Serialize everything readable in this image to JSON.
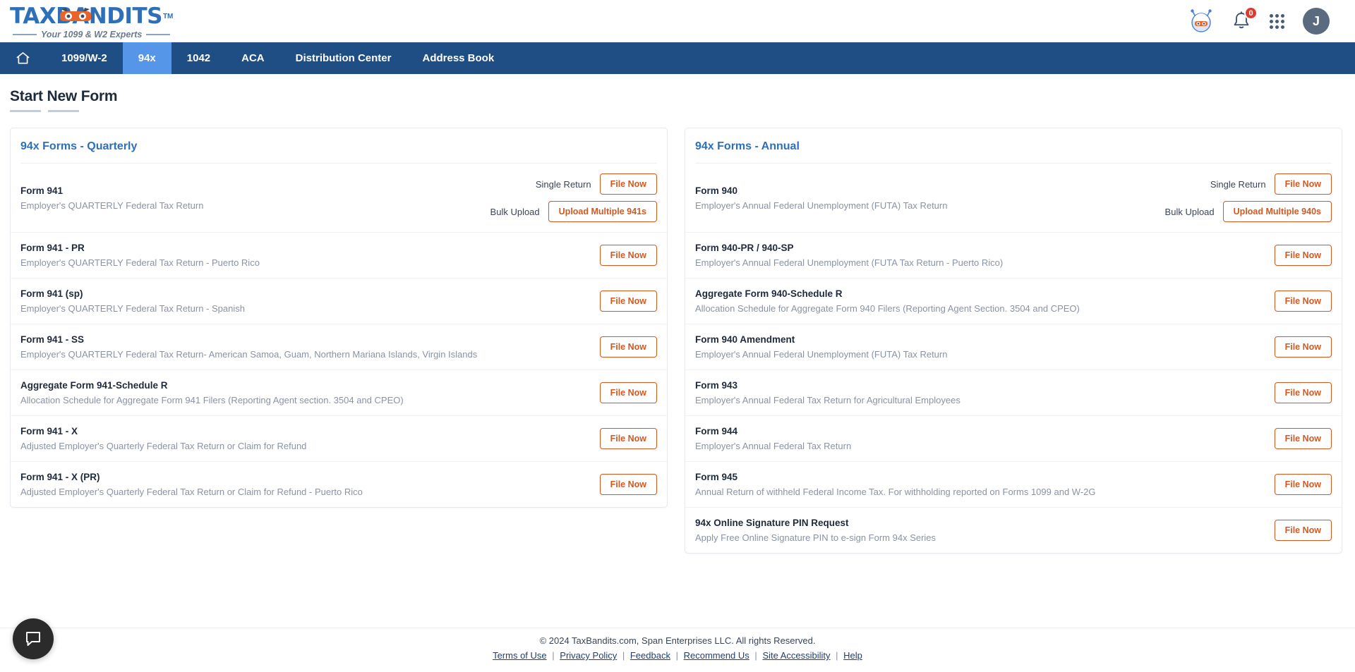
{
  "header": {
    "logo_text": "TAXBANDITS",
    "logo_tm": "TM",
    "tagline": "Your 1099 & W2 Experts",
    "notification_count": "0",
    "avatar_initial": "J"
  },
  "nav": {
    "home_label": "Home",
    "items": [
      {
        "label": "1099/W-2",
        "active": false
      },
      {
        "label": "94x",
        "active": true
      },
      {
        "label": "1042",
        "active": false
      },
      {
        "label": "ACA",
        "active": false
      },
      {
        "label": "Distribution Center",
        "active": false
      },
      {
        "label": "Address Book",
        "active": false
      }
    ]
  },
  "page": {
    "title": "Start New Form"
  },
  "labels": {
    "single_return": "Single Return",
    "bulk_upload": "Bulk Upload",
    "file_now": "File Now"
  },
  "cards": {
    "quarterly": {
      "title": "94x Forms - Quarterly",
      "rows": [
        {
          "name": "Form 941",
          "desc": "Employer's QUARTERLY Federal Tax Return",
          "single_label": "Single Return",
          "single_button": "File Now",
          "bulk_label": "Bulk Upload",
          "bulk_button": "Upload Multiple 941s"
        },
        {
          "name": "Form 941 - PR",
          "desc": "Employer's QUARTERLY Federal Tax Return - Puerto Rico",
          "single_button": "File Now"
        },
        {
          "name": "Form 941 (sp)",
          "desc": "Employer's QUARTERLY Federal Tax Return - Spanish",
          "single_button": "File Now"
        },
        {
          "name": "Form 941 - SS",
          "desc": "Employer's QUARTERLY Federal Tax Return- American Samoa, Guam, Northern Mariana Islands, Virgin Islands",
          "single_button": "File Now"
        },
        {
          "name": "Aggregate Form 941-Schedule R",
          "desc": "Allocation Schedule for Aggregate Form 941 Filers (Reporting Agent section. 3504 and CPEO)",
          "single_button": "File Now"
        },
        {
          "name": "Form 941 - X",
          "desc": "Adjusted Employer's Quarterly Federal Tax Return or Claim for Refund",
          "single_button": "File Now"
        },
        {
          "name": "Form 941 - X (PR)",
          "desc": "Adjusted Employer's Quarterly Federal Tax Return or Claim for Refund - Puerto Rico",
          "single_button": "File Now"
        }
      ]
    },
    "annual": {
      "title": "94x Forms - Annual",
      "rows": [
        {
          "name": "Form 940",
          "desc": "Employer's Annual Federal Unemployment (FUTA) Tax Return",
          "single_label": "Single Return",
          "single_button": "File Now",
          "bulk_label": "Bulk Upload",
          "bulk_button": "Upload Multiple 940s"
        },
        {
          "name": "Form 940-PR / 940-SP",
          "desc": "Employer's Annual Federal Unemployment (FUTA Tax Return - Puerto Rico)",
          "single_button": "File Now"
        },
        {
          "name": "Aggregate Form 940-Schedule R",
          "desc": "Allocation Schedule for Aggregate Form 940 Filers (Reporting Agent Section. 3504 and CPEO)",
          "single_button": "File Now"
        },
        {
          "name": "Form 940 Amendment",
          "desc": "Employer's Annual Federal Unemployment (FUTA) Tax Return",
          "single_button": "File Now"
        },
        {
          "name": "Form 943",
          "desc": "Employer's Annual Federal Tax Return for Agricultural Employees",
          "single_button": "File Now"
        },
        {
          "name": "Form 944",
          "desc": "Employer's Annual Federal Tax Return",
          "single_button": "File Now"
        },
        {
          "name": "Form 945",
          "desc": "Annual Return of withheld Federal Income Tax. For withholding reported on Forms 1099 and W-2G",
          "single_button": "File Now"
        },
        {
          "name": "94x Online Signature PIN Request",
          "desc": "Apply Free Online Signature PIN to e-sign Form 94x Series",
          "single_button": "File Now"
        }
      ]
    }
  },
  "footer": {
    "copyright": "© 2024 TaxBandits.com, Span Enterprises LLC. All rights Reserved.",
    "links": [
      "Terms of Use",
      "Privacy Policy",
      "Feedback",
      "Recommend Us",
      "Site Accessibility",
      "Help"
    ],
    "separator": "|"
  },
  "colors": {
    "nav_blue": "#1F4E85",
    "nav_active": "#5596E8",
    "accent_orange": "#D4581F",
    "brand_blue": "#2E6FBA",
    "badge_red": "#E03A2F"
  }
}
